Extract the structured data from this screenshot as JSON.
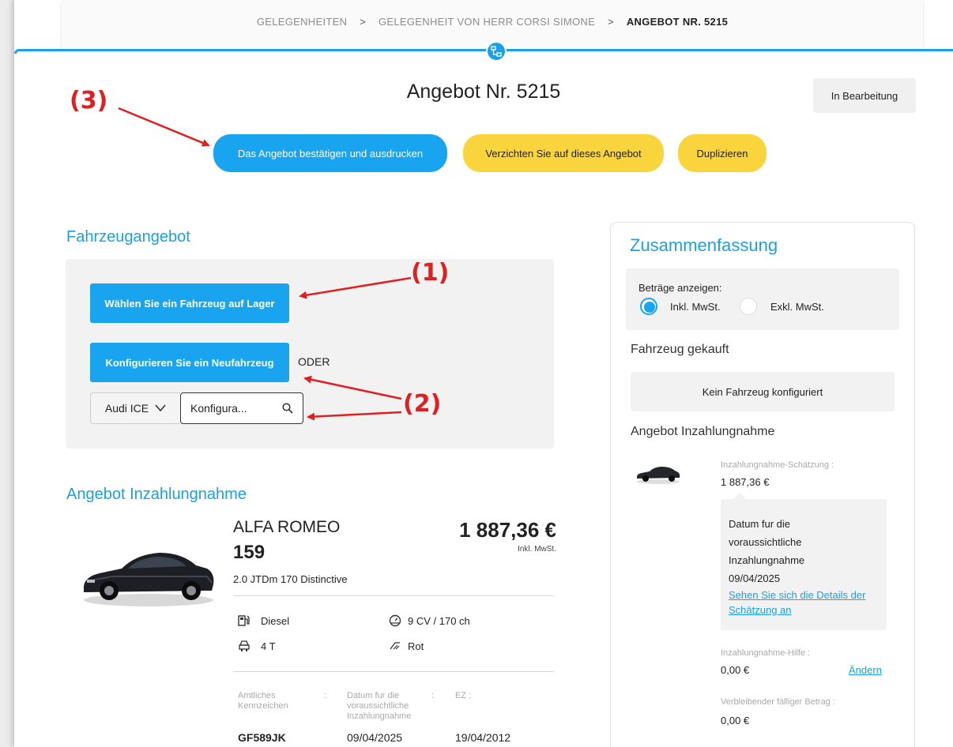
{
  "breadcrumb": {
    "items": [
      "GELEGENHEITEN",
      "GELEGENHEIT VON HERR CORSI SIMONE"
    ],
    "current": "ANGEBOT NR. 5215"
  },
  "header": {
    "title": "Angebot Nr. 5215",
    "status": "In Bearbeitung"
  },
  "actions": {
    "confirm_print": "Das Angebot bestätigen und ausdrucken",
    "decline": "Verzichten Sie auf dieses Angebot",
    "duplicate": "Duplizieren"
  },
  "annotations": {
    "a1": "(1)",
    "a2": "(2)",
    "a3": "(3)"
  },
  "vehicle_offer": {
    "title": "Fahrzeugangebot",
    "choose_stock": "Wählen Sie ein Fahrzeug auf Lager",
    "configure_new": "Konfigurieren Sie ein Neufahrzeug",
    "or_label": "ODER",
    "brand_select": "Audi ICE",
    "config_input_value": "Konfigura..."
  },
  "trade_in": {
    "title": "Angebot Inzahlungnahme",
    "make": "ALFA ROMEO",
    "model": "159",
    "version": "2.0 JTDm 170 Distinctive",
    "price": "1 887,36 €",
    "price_note": "Inkl. MwSt.",
    "fuel": "Diesel",
    "power": "9 CV / 170 ch",
    "doors": "4 T",
    "color": "Rot",
    "plate_label": "Amtliches Kennzeichen",
    "plate_sep": ":",
    "date_label": "Datum fur die voraussichtliche Inzahlungnahme",
    "date_sep": ":",
    "ez_label": "EZ :",
    "plate_value": "GF589JK",
    "date_value": "09/04/2025",
    "ez_value": "19/04/2012"
  },
  "summary": {
    "title": "Zusammenfassung",
    "amounts_label": "Beträge anzeigen:",
    "incl_label": "Inkl. MwSt.",
    "excl_label": "Exkl. MwSt.",
    "vehicle_bought": "Fahrzeug gekauft",
    "no_vehicle": "Kein Fahrzeug konfiguriert",
    "trade_in_title": "Angebot Inzahlungnahme",
    "estimate_label": "Inzahlungnahme-Schätzung :",
    "estimate_value": "1 887,36 €",
    "tooltip_l1": "Datum fur die",
    "tooltip_l2": "voraussichtliche",
    "tooltip_l3": "Inzahlungnahme",
    "tooltip_date": "09/04/2025",
    "details_link_l1": "Sehen Sie sich die Details der",
    "details_link_l2": "Schätzung an",
    "aid_label": "Inzahlungnahme-Hilfe :",
    "aid_value": "0,00 €",
    "change_link": "Ändern",
    "remaining_label": "Verbleibender fälliger Betrag :",
    "remaining_value": "0,00 €"
  }
}
